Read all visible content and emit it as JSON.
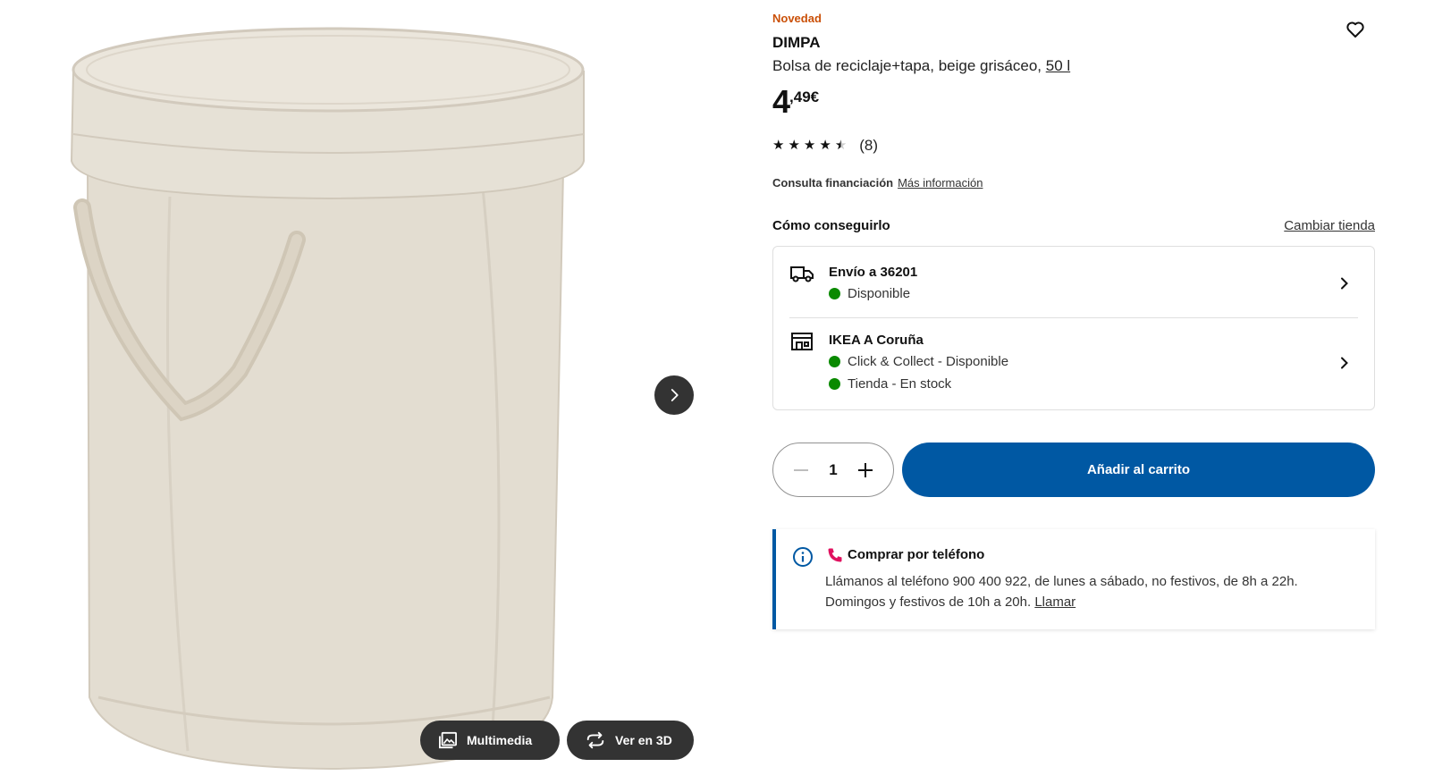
{
  "gallery": {
    "next_icon": "chevron-right-icon",
    "multimedia_label": "Multimedia",
    "view3d_label": "Ver en 3D"
  },
  "product": {
    "badge": "Novedad",
    "name": "DIMPA",
    "description": "Bolsa de reciclaje+tapa, beige grisáceo,",
    "size_link": "50 l",
    "price_integer": "4",
    "price_decimal": ",49€",
    "rating_value": 4.5,
    "rating_max": 5,
    "rating_count": "(8)",
    "financing_label": "Consulta financiación",
    "financing_link": "Más información"
  },
  "availability": {
    "title": "Cómo conseguirlo",
    "change_store": "Cambiar tienda",
    "shipping": {
      "title": "Envío a 36201",
      "status": "Disponible"
    },
    "store": {
      "title": "IKEA A Coruña",
      "status_collect": "Click & Collect - Disponible",
      "status_store": "Tienda - En stock"
    }
  },
  "cart": {
    "quantity": "1",
    "add_label": "Añadir al carrito"
  },
  "phone": {
    "title": "Comprar por teléfono",
    "text": "Llámanos al teléfono 900 400 922, de lunes a sábado, no festivos, de 8h a 22h. Domingos y festivos de 10h a 20h.",
    "call_link": "Llamar"
  },
  "colors": {
    "accent_blue": "#0058a3",
    "badge_orange": "#ca5008",
    "status_green": "#0a8a00",
    "phone_pink": "#e0115f"
  }
}
